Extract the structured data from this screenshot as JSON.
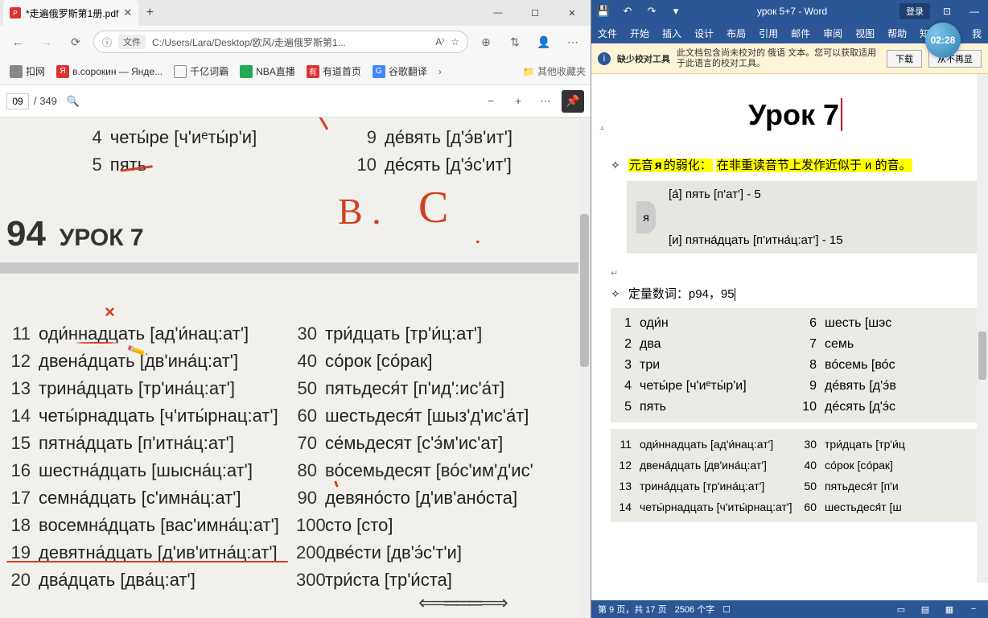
{
  "browser": {
    "tab_title": "*走遍俄罗斯第1册.pdf",
    "url_prefix": "文件",
    "url_path": "C:/Users/Lara/Desktop/欧风/走遍俄罗斯第1...",
    "bookmarks": [
      {
        "label": "扣网",
        "color": "#888"
      },
      {
        "label": "в.сорокин — Янде...",
        "color": "#d33"
      },
      {
        "label": "千亿词霸",
        "color": "#fff"
      },
      {
        "label": "NBA直播",
        "color": "#2a5"
      },
      {
        "label": "有道首页",
        "color": "#d33"
      },
      {
        "label": "谷歌翻译",
        "color": "#48f"
      }
    ],
    "bm_folder": "其他收藏夹",
    "pdf": {
      "page_input": "09",
      "page_total": "/ 349"
    },
    "page_top": {
      "left": [
        {
          "n": "4",
          "t": "четы́ре [ч'иᵉты́р'и]"
        },
        {
          "n": "5",
          "t": "пять"
        }
      ],
      "right": [
        {
          "n": "9",
          "t": "де́вять [д'э́в'ит']"
        },
        {
          "n": "10",
          "t": "де́сять [д'э́с'ит']"
        }
      ],
      "header": "УРОК 7",
      "header_num": "94"
    },
    "page_bot": {
      "left": [
        {
          "n": "11",
          "t": "оди́ннадцать [ад'и́нац:ат']"
        },
        {
          "n": "12",
          "t": "двена́дцать [дв'ина́ц:ат']"
        },
        {
          "n": "13",
          "t": "трина́дцать [тр'ина́ц:ат']"
        },
        {
          "n": "14",
          "t": "четы́рнадцать [ч'иты́рнац:ат']"
        },
        {
          "n": "15",
          "t": "пятна́дцать [п'итна́ц:ат']"
        },
        {
          "n": "16",
          "t": "шестна́дцать [шысна́ц:ат']"
        },
        {
          "n": "17",
          "t": "семна́дцать [с'имна́ц:ат']"
        },
        {
          "n": "18",
          "t": "восемна́дцать [вас'имна́ц:ат']"
        },
        {
          "n": "19",
          "t": "девятна́дцать [д'ив'итна́ц:ат']"
        },
        {
          "n": "20",
          "t": "два́дцать [два́ц:ат']"
        }
      ],
      "right": [
        {
          "n": "30",
          "t": "три́дцать [тр'и́ц:ат']"
        },
        {
          "n": "40",
          "t": "со́рок [со́рак]"
        },
        {
          "n": "50",
          "t": "пятьдеся́т [п'ид':ис'а́т]"
        },
        {
          "n": "60",
          "t": "шестьдеся́т [шыз'д'ис'а́т]"
        },
        {
          "n": "70",
          "t": "се́мьдесят [с'э́м'ис'ат]"
        },
        {
          "n": "80",
          "t": "во́семьдесят [во́с'им'д'ис'"
        },
        {
          "n": "90",
          "t": "девяно́сто [д'ив'ано́ста]"
        },
        {
          "n": "100",
          "t": "сто [сто]"
        },
        {
          "n": "200",
          "t": "две́сти [дв'э́с'т'и]"
        },
        {
          "n": "300",
          "t": "три́ста [тр'и́ста]"
        }
      ]
    }
  },
  "word": {
    "qat": {
      "save": "💾",
      "undo": "↶",
      "redo": "↷"
    },
    "title": "урок 5+7  -  Word",
    "login": "登录",
    "ribbon": [
      "文件",
      "开始",
      "插入",
      "设计",
      "布局",
      "引用",
      "邮件",
      "审阅",
      "视图",
      "帮助",
      "知网",
      "我"
    ],
    "clock": "02:28",
    "msg": {
      "title": "缺少校对工具",
      "desc": "此文档包含尚未校对的 俄语 文本。您可以获取适用于此语言的校对工具。",
      "btn1": "下载",
      "btn2": "从不再显"
    },
    "doc": {
      "h1": "Урок 7",
      "bullet1_pre": "元音",
      "bullet1_ya": "я",
      "bullet1_mid": "的弱化：",
      "bullet1_hl": "在非重读音节上发作近似于 и 的音。",
      "ex1": "[а́]    пять [п'ат'] - 5",
      "ex_ya": "я",
      "ex2": "[и]    пятна́дцать [п'итна́ц:ат'] - 15",
      "bullet2": "定量数词：p94，95",
      "tbl1": {
        "l": [
          {
            "n": "1",
            "t": "оди́н"
          },
          {
            "n": "2",
            "t": "два"
          },
          {
            "n": "3",
            "t": "три"
          },
          {
            "n": "4",
            "t": "четы́ре [ч'иᵉты́р'и]"
          },
          {
            "n": "5",
            "t": "пять"
          }
        ],
        "r": [
          {
            "n": "6",
            "t": "шесть [шэс"
          },
          {
            "n": "7",
            "t": "семь"
          },
          {
            "n": "8",
            "t": "во́семь [во́с"
          },
          {
            "n": "9",
            "t": "де́вять [д'э́в"
          },
          {
            "n": "10",
            "t": "де́сять [д'э́с"
          }
        ]
      },
      "tbl2": {
        "l": [
          {
            "n": "11",
            "t": "оди́ннадцать [ад'и́нац:ат']"
          },
          {
            "n": "12",
            "t": "двена́дцать [дв'ина́ц:ат']"
          },
          {
            "n": "13",
            "t": "трина́дцать [тр'ина́ц:ат']"
          },
          {
            "n": "14",
            "t": "четы́рнадцать [ч'иты́рнац:ат']"
          }
        ],
        "r": [
          {
            "n": "30",
            "t": "три́дцать [тр'и́ц"
          },
          {
            "n": "40",
            "t": "со́рок [со́рак]"
          },
          {
            "n": "50",
            "t": "пятьдеся́т [п'и"
          },
          {
            "n": "60",
            "t": "шестьдеся́т [ш"
          }
        ]
      }
    },
    "status": {
      "page": "第 9 页，共 17 页",
      "words": "2506 个字"
    }
  }
}
